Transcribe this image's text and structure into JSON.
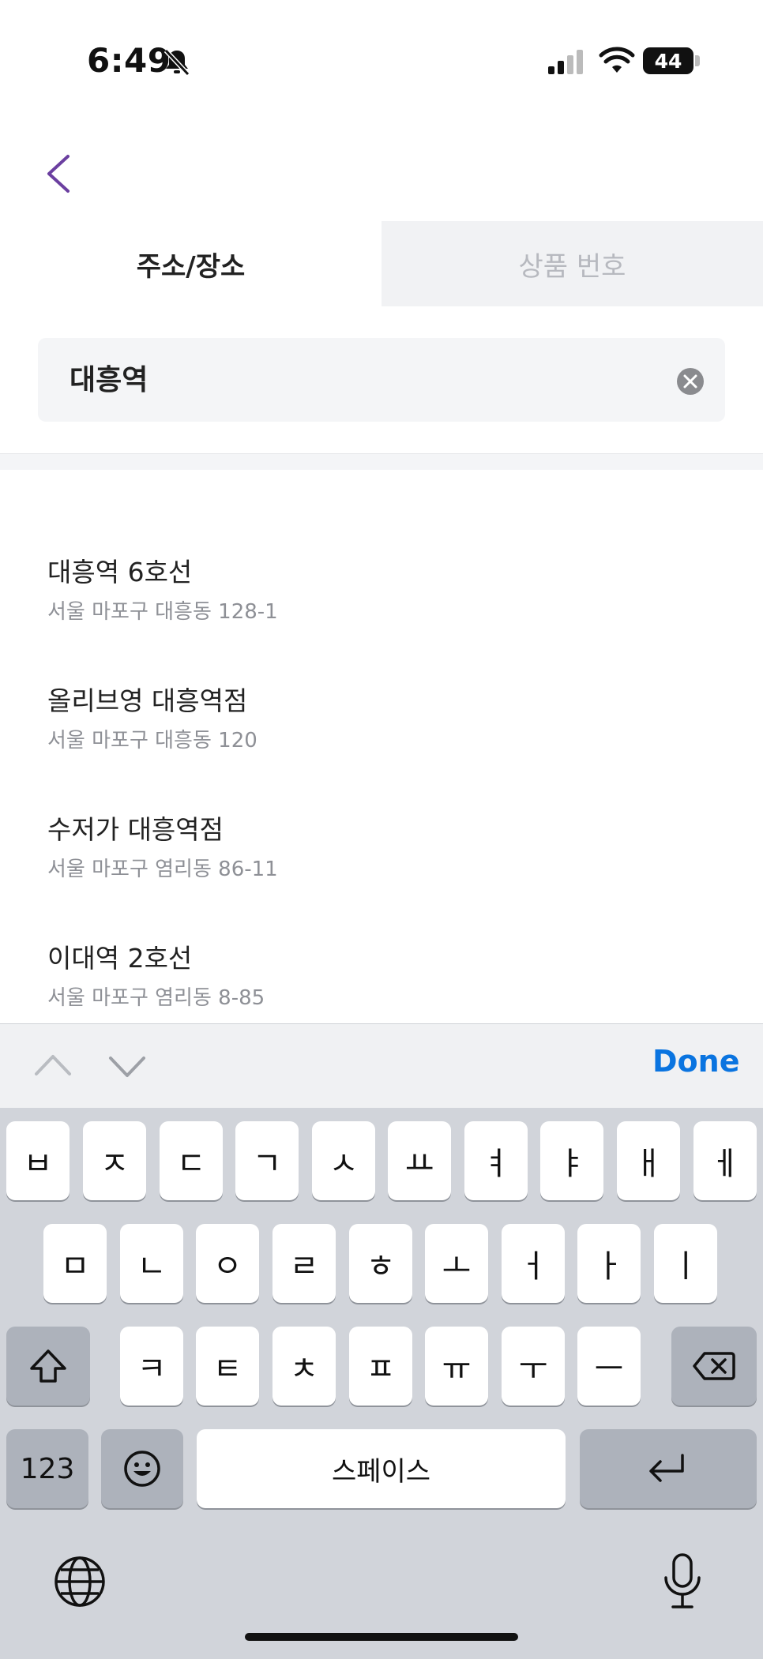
{
  "status_bar": {
    "time": "6:49",
    "battery": "44"
  },
  "tabs": {
    "address": "주소/장소",
    "product_number": "상품 번호"
  },
  "search": {
    "value": "대흥역"
  },
  "results": [
    {
      "title": "대흥역 6호선",
      "address": "서울 마포구 대흥동 128-1"
    },
    {
      "title": "올리브영 대흥역점",
      "address": "서울 마포구 대흥동 120"
    },
    {
      "title": "수저가 대흥역점",
      "address": "서울 마포구 염리동 86-11"
    },
    {
      "title": "이대역 2호선",
      "address": "서울 마포구 염리동 8-85"
    }
  ],
  "keyboard": {
    "done_label": "Done",
    "row1": [
      "ㅂ",
      "ㅈ",
      "ㄷ",
      "ㄱ",
      "ㅅ",
      "ㅛ",
      "ㅕ",
      "ㅑ",
      "ㅐ",
      "ㅔ"
    ],
    "row2": [
      "ㅁ",
      "ㄴ",
      "ㅇ",
      "ㄹ",
      "ㅎ",
      "ㅗ",
      "ㅓ",
      "ㅏ",
      "ㅣ"
    ],
    "row3": [
      "ㅋ",
      "ㅌ",
      "ㅊ",
      "ㅍ",
      "ㅠ",
      "ㅜ",
      "ㅡ"
    ],
    "numbers_label": "123",
    "space_label": "스페이스"
  },
  "colors": {
    "accent": "#6b3fa0",
    "done": "#0a74e0",
    "tab_inactive_bg": "#f1f2f4"
  },
  "icons": [
    "bell-slash-icon",
    "signal-icon",
    "wifi-icon",
    "back-chevron-icon",
    "clear-icon",
    "chevron-up-icon",
    "chevron-down-icon",
    "shift-icon",
    "delete-icon",
    "emoji-icon",
    "return-icon",
    "globe-icon",
    "microphone-icon"
  ]
}
